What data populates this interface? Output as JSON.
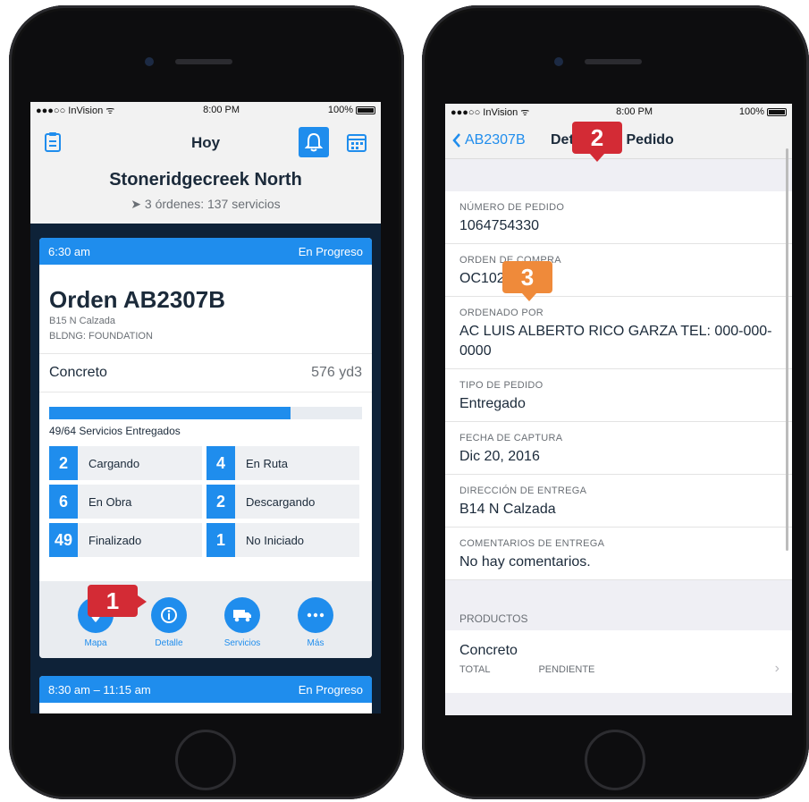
{
  "colors": {
    "accent": "#1f8ded",
    "callout_red": "#d32b35",
    "callout_orange": "#ef8a3a",
    "nav_dark": "#0e2238"
  },
  "status_left": {
    "carrier": "●●●○○ InVision ᯤ",
    "time": "8:00 PM",
    "battery": "100%"
  },
  "status_right": {
    "carrier": "●●●○○ InVision ᯤ",
    "time": "8:00 PM",
    "battery": "100%"
  },
  "left": {
    "nav": {
      "title": "Hoy",
      "icons": [
        "clipboard-icon",
        "bell-icon",
        "calendar-icon"
      ]
    },
    "site": {
      "name": "Stoneridgecreek North",
      "summary": "3 órdenes: 137 servicios"
    },
    "card1": {
      "time": "6:30 am",
      "status": "En Progreso",
      "order": "Orden AB2307B",
      "address": "B15 N Calzada",
      "building": "BLDNG: FOUNDATION",
      "product": "Concreto",
      "quantity": "576 yd3",
      "progress_fraction": 0.77,
      "progress_label": "49/64 Servicios Entregados",
      "statuses": [
        {
          "count": "2",
          "label": "Cargando"
        },
        {
          "count": "4",
          "label": "En Ruta"
        },
        {
          "count": "6",
          "label": "En Obra"
        },
        {
          "count": "2",
          "label": "Descargando"
        },
        {
          "count": "49",
          "label": "Finalizado"
        },
        {
          "count": "1",
          "label": "No Iniciado"
        }
      ],
      "actions": [
        {
          "label": "Mapa",
          "icon": "map-icon"
        },
        {
          "label": "Detalle",
          "icon": "info-icon"
        },
        {
          "label": "Servicios",
          "icon": "truck-icon"
        },
        {
          "label": "Más",
          "icon": "more-icon"
        }
      ]
    },
    "card2": {
      "time": "8:30 am – 11:15 am",
      "status": "En Progreso"
    }
  },
  "right": {
    "nav": {
      "back_label": "AB2307B",
      "title": "Detalle del Pedido"
    },
    "fields": [
      {
        "label": "NÚMERO DE PEDIDO",
        "value": "1064754330"
      },
      {
        "label": "ORDEN DE COMPRA",
        "value": "OC1023894"
      },
      {
        "label": "ORDENADO POR",
        "value": "AC LUIS ALBERTO RICO GARZA TEL: 000-000-0000"
      },
      {
        "label": "TIPO DE PEDIDO",
        "value": "Entregado"
      },
      {
        "label": "FECHA DE CAPTURA",
        "value": "Dic 20, 2016"
      },
      {
        "label": "DIRECCIÓN DE ENTREGA",
        "value": "B14 N Calzada"
      },
      {
        "label": "COMENTARIOS DE ENTREGA",
        "value": "No hay comentarios."
      }
    ],
    "products_header": "PRODUCTOS",
    "product": {
      "name": "Concreto",
      "col1": "TOTAL",
      "col2": "PENDIENTE"
    }
  },
  "callouts": [
    "1",
    "2",
    "3"
  ]
}
